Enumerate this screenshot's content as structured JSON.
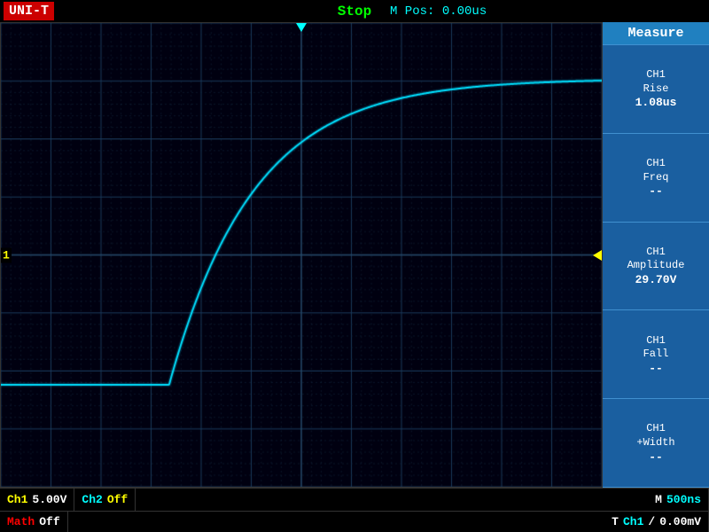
{
  "header": {
    "brand": "UNI-T",
    "status": "Stop",
    "mpos_label": "M Pos:",
    "mpos_value": "0.00us",
    "measure_title": "Measure"
  },
  "measurements": [
    {
      "channel": "CH1",
      "name": "Rise",
      "value": "1.08us"
    },
    {
      "channel": "CH1",
      "name": "Freq",
      "value": "--"
    },
    {
      "channel": "CH1",
      "name": "Amplitude",
      "value": "29.70V"
    },
    {
      "channel": "CH1",
      "name": "Fall",
      "value": "--"
    },
    {
      "channel": "CH1",
      "name": "+Width",
      "value": "--"
    }
  ],
  "bottom": {
    "ch1_label": "Ch1",
    "ch1_value": "5.00V",
    "ch2_label": "Ch2",
    "ch2_value": "Off",
    "time_label": "M",
    "time_value": "500ns",
    "math_label": "Math",
    "math_value": "Off",
    "trigger_label": "T",
    "trigger_ch": "Ch1",
    "trigger_symbol": "/",
    "trigger_value": "0.00mV"
  },
  "waveform": {
    "signal_color": "#00ffff",
    "grid_color": "#1a3a5a",
    "dashed_color": "#2a4a6a"
  },
  "markers": {
    "trigger_top": "▼",
    "trigger_right": "◄",
    "ch1_marker": "1"
  }
}
